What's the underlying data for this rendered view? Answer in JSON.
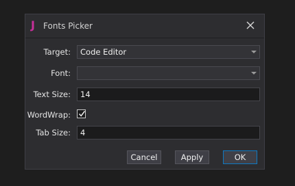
{
  "dialog": {
    "title": "Fonts Picker",
    "app_icon": "J",
    "close_icon": "close-icon"
  },
  "form": {
    "target_label": "Target:",
    "target_value": "Code Editor",
    "font_label": "Font:",
    "font_value": "",
    "text_size_label": "Text Size:",
    "text_size_value": "14",
    "wordwrap_label": "WordWrap:",
    "wordwrap_checked": true,
    "tab_size_label": "Tab Size:",
    "tab_size_value": "4"
  },
  "buttons": {
    "cancel": "Cancel",
    "apply": "Apply",
    "ok": "OK"
  },
  "colors": {
    "accent": "#0e7ac4",
    "app_icon": "#c72f9a"
  }
}
